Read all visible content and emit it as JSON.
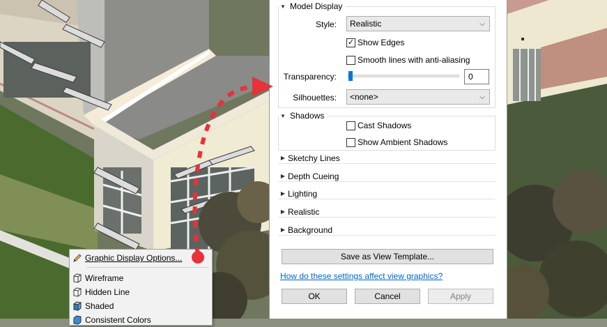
{
  "model_display": {
    "header": "Model Display",
    "style_label": "Style:",
    "style_value": "Realistic",
    "show_edges": "Show Edges",
    "smooth_lines": "Smooth lines with anti-aliasing",
    "transparency_label": "Transparency:",
    "transparency_value": "0",
    "transparency_level_percent": 0,
    "silhouettes_label": "Silhouettes:",
    "silhouettes_value": "<none>"
  },
  "shadows": {
    "header": "Shadows",
    "cast_shadows": "Cast Shadows",
    "ambient_shadows": "Show Ambient Shadows"
  },
  "collapsed_sections": [
    "Sketchy Lines",
    "Depth Cueing",
    "Lighting",
    "Realistic",
    "Background"
  ],
  "buttons": {
    "save_template": "Save as View Template...",
    "ok": "OK",
    "cancel": "Cancel",
    "apply": "Apply"
  },
  "help_link": "How do these settings affect view graphics?",
  "context_menu": {
    "graphic_display_options": "Graphic Display Options...",
    "items": [
      "Wireframe",
      "Hidden Line",
      "Shaded",
      "Consistent Colors"
    ]
  },
  "colors": {
    "accent": "#0078d7",
    "link": "#0066cc",
    "annotation": "#e8313a"
  },
  "icons": {
    "expanded": "triangle-down-icon",
    "collapsed": "triangle-right-icon",
    "dropdown": "chevron-down-icon",
    "check": "checkmark-icon",
    "gdo": "pencil-icon",
    "visual_style": "cube-icon"
  }
}
